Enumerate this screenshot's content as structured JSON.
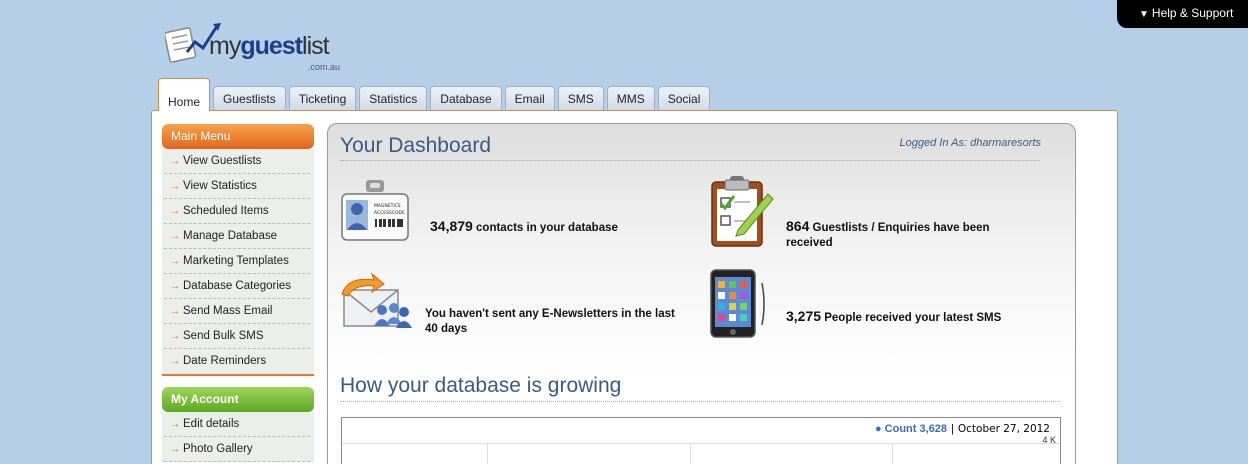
{
  "help": {
    "label": "Help & Support"
  },
  "logo": {
    "prefix": "my",
    "bold": "guest",
    "suffix": "list",
    "domain": ".com.au"
  },
  "tabs": [
    {
      "label": "Home",
      "active": true
    },
    {
      "label": "Guestlists"
    },
    {
      "label": "Ticketing"
    },
    {
      "label": "Statistics"
    },
    {
      "label": "Database"
    },
    {
      "label": "Email"
    },
    {
      "label": "SMS"
    },
    {
      "label": "MMS"
    },
    {
      "label": "Social"
    }
  ],
  "main_menu": {
    "title": "Main Menu",
    "items": [
      "View Guestlists",
      "View Statistics",
      "Scheduled Items",
      "Manage Database",
      "Marketing Templates",
      "Database Categories",
      "Send Mass Email",
      "Send Bulk SMS",
      "Date Reminders"
    ]
  },
  "my_account": {
    "title": "My Account",
    "items": [
      "Edit details",
      "Photo Gallery"
    ]
  },
  "dashboard": {
    "title": "Your Dashboard",
    "logged_in": "Logged In As: dharmaresorts",
    "contacts": {
      "num": "34,879",
      "text": " contacts in your database"
    },
    "guestlists": {
      "num": "864",
      "text": " Guestlists / Enquiries have been received"
    },
    "newsletters": {
      "text": "You haven't sent any E-Newsletters in the last 40 days"
    },
    "sms": {
      "num": "3,275",
      "text": " People received your latest SMS"
    },
    "badge_text": {
      "line1": "MAGNETICS",
      "line2": "ACCESSCODE"
    }
  },
  "growth": {
    "title": "How your database is growing",
    "legend_bullet": "●",
    "legend_count_label": "Count 3,628",
    "legend_sep": "|",
    "legend_date": "October 27, 2012",
    "y_tick": "4 K"
  },
  "colors": {
    "accent_orange": "#e2661e",
    "accent_green": "#5ca824",
    "title_blue": "#3a5a87"
  }
}
